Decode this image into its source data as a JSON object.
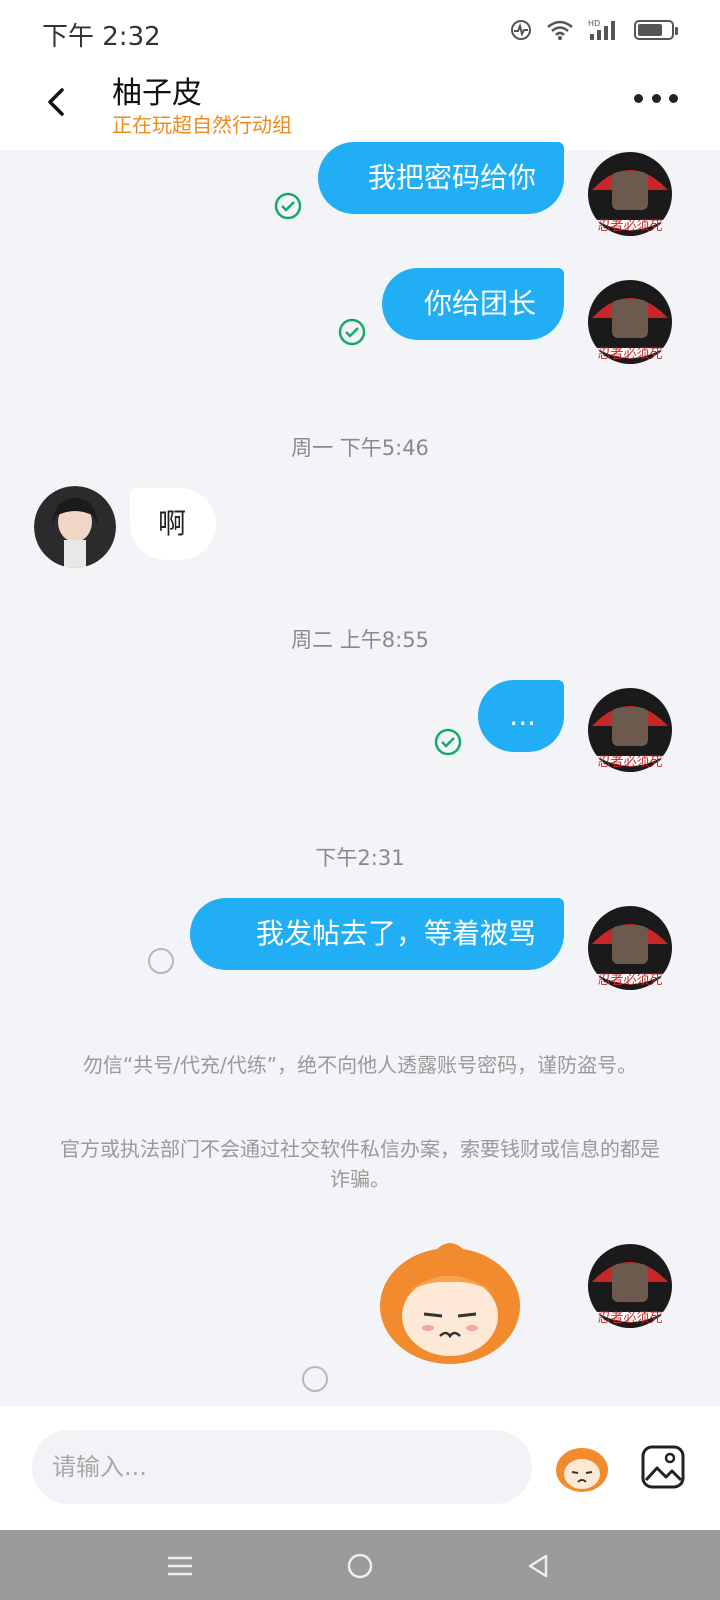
{
  "status_bar": {
    "time": "下午 2:32",
    "battery_level": 0.75
  },
  "header": {
    "title": "柚子皮",
    "subtitle": "正在玩超自然行动组"
  },
  "messages": [
    {
      "type": "out",
      "text": "我把密码给你",
      "status": "read"
    },
    {
      "type": "out",
      "text": "你给团长",
      "status": "read"
    },
    {
      "type": "timestamp",
      "text": "周一 下午5:46"
    },
    {
      "type": "in",
      "text": "啊"
    },
    {
      "type": "timestamp",
      "text": "周二 上午8:55"
    },
    {
      "type": "out",
      "text": "...",
      "status": "read"
    },
    {
      "type": "timestamp",
      "text": "下午2:31"
    },
    {
      "type": "out",
      "text": "我发帖去了，等着被骂",
      "status": "pending"
    },
    {
      "type": "out_sticker",
      "sticker": "orange-hair-character-sticker",
      "status": "pending"
    }
  ],
  "notice": {
    "line1": "勿信“共号/代充/代练”，绝不向他人透露账号密码，谨防盗号。",
    "line2": "官方或执法部门不会通过社交软件私信办案，索要钱财或信息的都是诈骗。"
  },
  "input": {
    "placeholder": "请输入..."
  },
  "colors": {
    "bubble_out": "#22aef4",
    "subtitle": "#f08a1c",
    "read_check": "#1aa866"
  }
}
